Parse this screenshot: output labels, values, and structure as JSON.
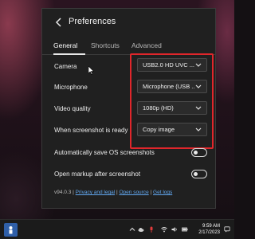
{
  "header": {
    "title": "Preferences"
  },
  "tabs": [
    {
      "label": "General"
    },
    {
      "label": "Shortcuts"
    },
    {
      "label": "Advanced"
    }
  ],
  "settings": {
    "camera": {
      "label": "Camera",
      "value": "USB2.0 HD UVC ..."
    },
    "microphone": {
      "label": "Microphone",
      "value": "Microphone (USB ..."
    },
    "video_quality": {
      "label": "Video quality",
      "value": "1080p (HD)"
    },
    "screenshot_ready": {
      "label": "When screenshot is ready",
      "value": "Copy image"
    },
    "auto_save": {
      "label": "Automatically save OS screenshots",
      "enabled": false
    },
    "open_markup": {
      "label": "Open markup after screenshot",
      "enabled": false
    }
  },
  "footer": {
    "version": "v94.0.3",
    "sep": "|",
    "privacy": "Privacy and legal",
    "open_source": "Open source",
    "logs": "Get logs"
  },
  "taskbar": {
    "time": "9:59 AM",
    "date": "2/17/2023"
  },
  "colors": {
    "panel_bg": "#202020",
    "highlight": "#e0262b",
    "link": "#62a8f0"
  }
}
